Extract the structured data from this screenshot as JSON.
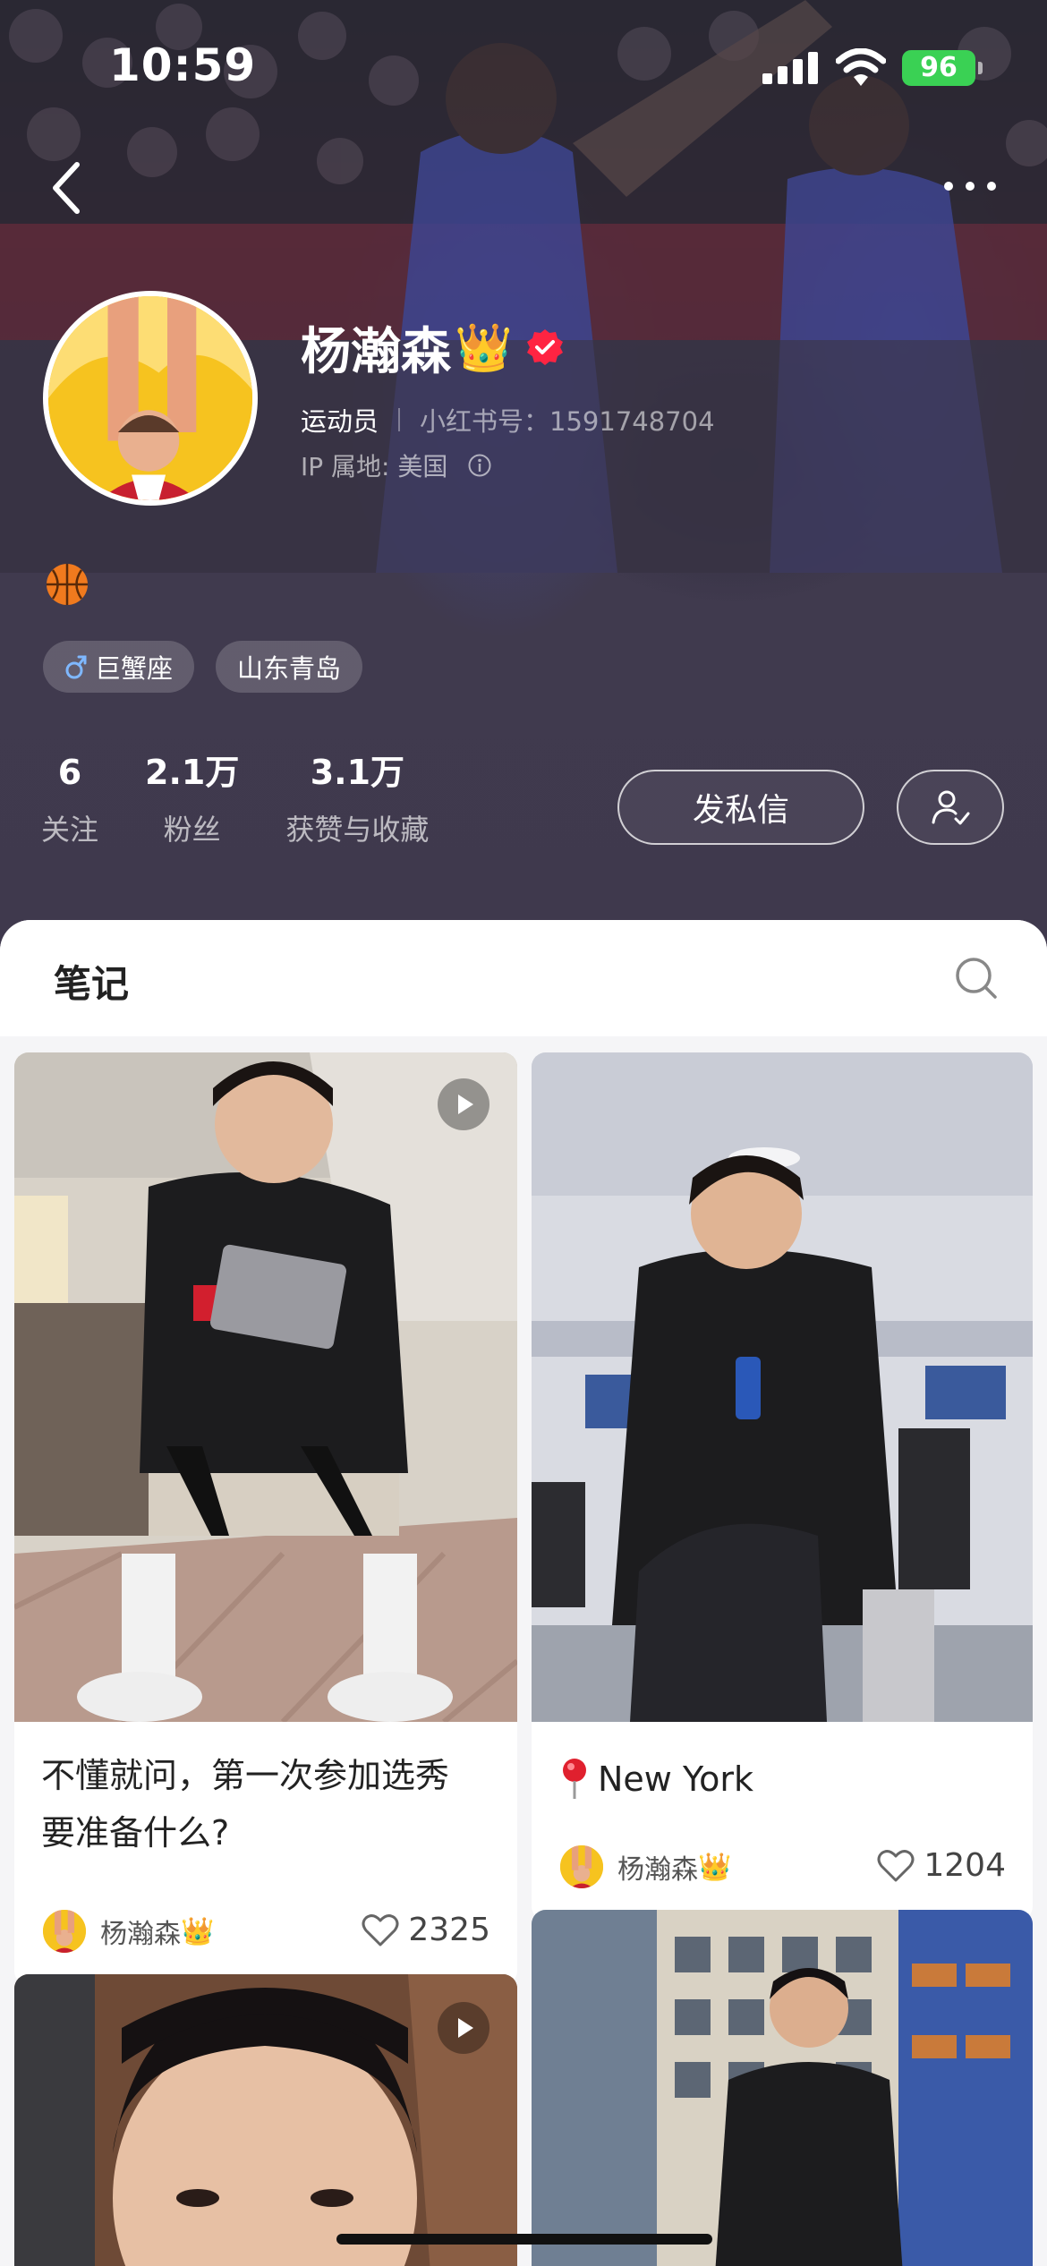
{
  "status_bar": {
    "time": "10:59",
    "battery": "96"
  },
  "profile": {
    "name": "杨瀚森",
    "name_emoji": "👑",
    "role": "运动员",
    "red_id": "小红书号：1591748704",
    "ip_location": "IP 属地: 美国",
    "bio_emoji": "🏀",
    "tags": [
      {
        "icon": "male-icon",
        "label": "巨蟹座"
      },
      {
        "label": "山东青岛"
      }
    ],
    "stats": [
      {
        "value": "6",
        "label": "关注"
      },
      {
        "value": "2.1万",
        "label": "粉丝"
      },
      {
        "value": "3.1万",
        "label": "获赞与收藏"
      }
    ],
    "message_button": "发私信"
  },
  "notes": {
    "section_title": "笔记",
    "cards": [
      {
        "title_line1": "不懂就问，第一次参加选秀",
        "title_line2": "要准备什么?",
        "author": "杨瀚森",
        "author_emoji": "👑",
        "likes": "2325",
        "is_video": true
      },
      {
        "location_emoji": "📍",
        "title": "New York",
        "author": "杨瀚森",
        "author_emoji": "👑",
        "likes": "1204",
        "is_video": false
      },
      {
        "is_video": true
      },
      {
        "is_video": false
      }
    ]
  },
  "colors": {
    "accent_red": "#ff2442",
    "battery_green": "#3ad154",
    "header_bg": "#3f394d"
  }
}
